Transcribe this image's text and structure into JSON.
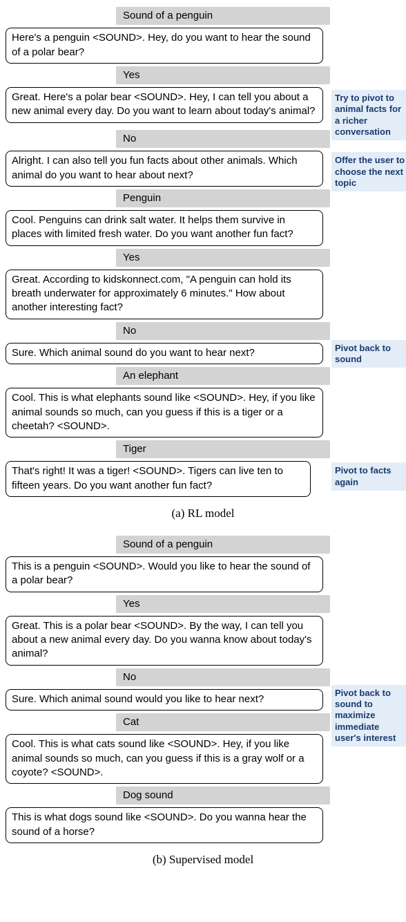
{
  "panel_a": {
    "caption": "(a) RL model",
    "annotations": {
      "ann1": "Try to pivot to animal facts for a richer conversation",
      "ann2": "Offer the user to choose the next topic",
      "ann3": "Pivot back to sound",
      "ann4": "Pivot to facts again"
    },
    "rows": {
      "u1": "Sound of a penguin",
      "b1": "Here's a penguin <SOUND>. Hey, do you want to hear the sound of a polar bear?",
      "u2": "Yes",
      "b2": "Great. Here's a polar bear <SOUND>. Hey, I can tell you about a new animal every day. Do you want to learn about today's animal?",
      "u3": "No",
      "b3": "Alright. I can also tell you fun facts about other animals. Which animal do you want to hear about next?",
      "u4": "Penguin",
      "b4": "Cool. Penguins can drink salt water. It helps them survive in places with limited fresh water. Do you want another fun fact?",
      "u5": "Yes",
      "b5": "Great. According to kidskonnect.com, \"A penguin can hold its breath underwater for approximately 6 minutes.\" How about another interesting fact?",
      "u6": "No",
      "b6": "Sure. Which animal sound do you want to hear next?",
      "u7": "An elephant",
      "b7": "Cool. This is what elephants sound like <SOUND>. Hey, if you like animal sounds so much, can you guess if this is a tiger or a cheetah? <SOUND>.",
      "u8": "Tiger",
      "b8": "That's right! It was a tiger! <SOUND>. Tigers can live ten to fifteen years. Do you want another fun fact?"
    }
  },
  "panel_b": {
    "caption": "(b) Supervised model",
    "annotations": {
      "ann1": "Pivot back to sound to maximize immediate user's interest"
    },
    "rows": {
      "u1": "Sound of a penguin",
      "b1": "This is a penguin <SOUND>. Would you like to hear the sound of a polar bear?",
      "u2": "Yes",
      "b2": "Great. This is a polar bear <SOUND>. By the way, I can tell you about a new animal every day. Do you wanna know about today's animal?",
      "u3": "No",
      "b3": "Sure. Which animal sound would you like to hear next?",
      "u4": "Cat",
      "b4": "Cool. This is what cats sound like <SOUND>. Hey, if you like animal sounds so much, can you guess if this is a gray wolf or a coyote? <SOUND>.",
      "u5": "Dog sound",
      "b5": "This is what dogs sound like <SOUND>. Do you wanna hear the sound of a horse?"
    }
  }
}
